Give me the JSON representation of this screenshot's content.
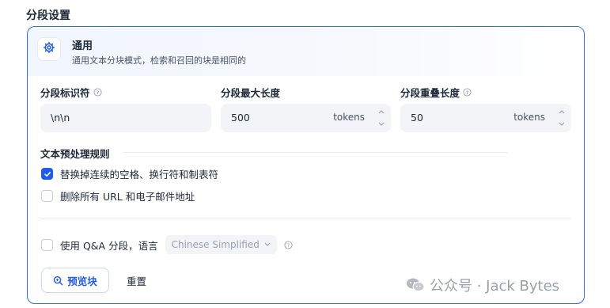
{
  "section_title": "分段设置",
  "mode": {
    "title": "通用",
    "description": "通用文本分块模式，检索和召回的块是相同的"
  },
  "fields": {
    "identifier": {
      "label": "分段标识符",
      "value": "\\n\\n"
    },
    "max_length": {
      "label": "分段最大长度",
      "value": "500",
      "unit": "tokens"
    },
    "overlap": {
      "label": "分段重叠长度",
      "value": "50",
      "unit": "tokens"
    }
  },
  "rules": {
    "title": "文本预处理规则",
    "items": [
      {
        "label": "替换掉连续的空格、换行符和制表符",
        "checked": true
      },
      {
        "label": "删除所有 URL 和电子邮件地址",
        "checked": false
      }
    ]
  },
  "qa": {
    "label": "使用 Q&A 分段，语言",
    "checked": false,
    "language": "Chinese Simplified"
  },
  "buttons": {
    "preview": "预览块",
    "reset": "重置"
  },
  "watermark": "公众号 · Jack Bytes",
  "colors": {
    "accent": "#1f5bf0",
    "card_border": "#2f6bf5",
    "field_bg": "#f2f4f7"
  }
}
